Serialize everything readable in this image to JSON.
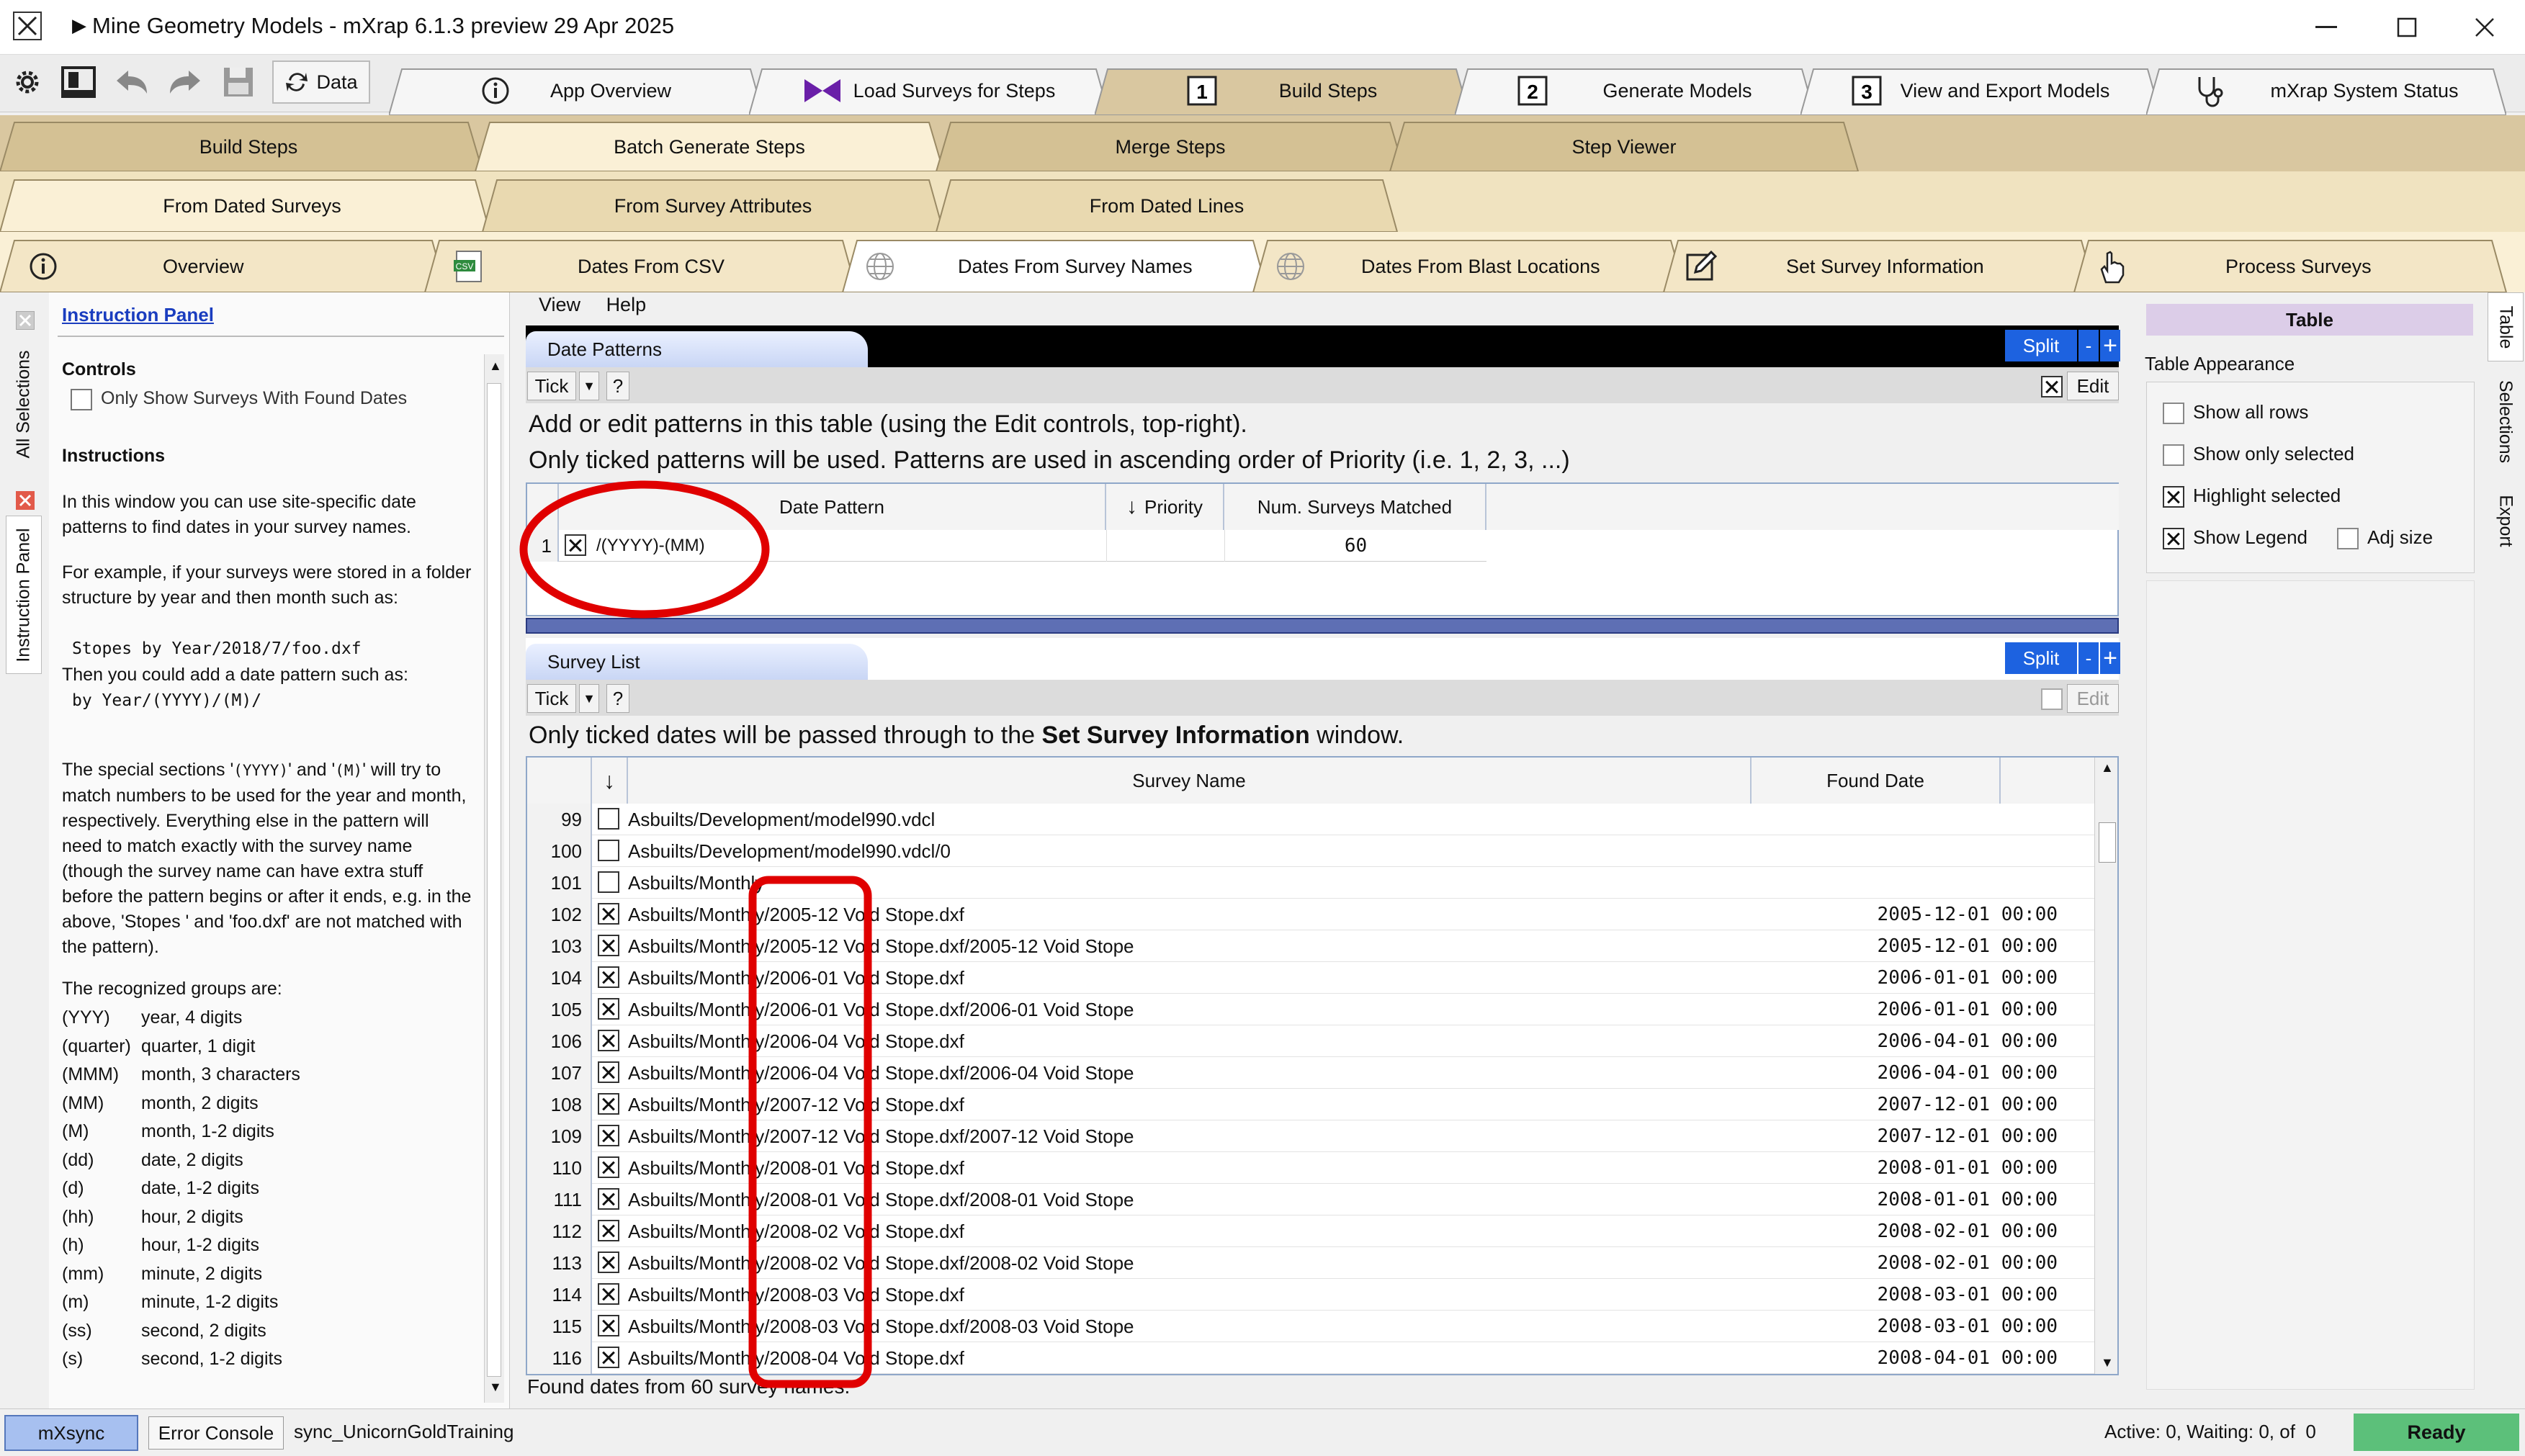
{
  "window": {
    "title": "Mine Geometry Models - mXrap 6.1.3 preview 29 Apr 2025"
  },
  "toolbar": {
    "data_label": "Data"
  },
  "main_tabs": [
    {
      "label": "App Overview",
      "icon": "info-icon"
    },
    {
      "label": "Load Surveys for Steps",
      "icon": "bowtie-icon"
    },
    {
      "label": "Build Steps",
      "icon": "step-1-icon"
    },
    {
      "label": "Generate Models",
      "icon": "step-2-icon"
    },
    {
      "label": "View and Export Models",
      "icon": "step-3-icon"
    },
    {
      "label": "mXrap System Status",
      "icon": "stethoscope-icon"
    }
  ],
  "sub_tabs": [
    "Build Steps",
    "Batch Generate Steps",
    "Merge Steps",
    "Step Viewer"
  ],
  "sub_sub_tabs": [
    "From Dated Surveys",
    "From Survey Attributes",
    "From Dated Lines"
  ],
  "page_tabs": [
    {
      "label": "Overview",
      "icon": "info-icon"
    },
    {
      "label": "Dates From CSV",
      "icon": "csv-icon"
    },
    {
      "label": "Dates From Survey Names",
      "icon": "globe-icon"
    },
    {
      "label": "Dates From Blast Locations",
      "icon": "globe-icon"
    },
    {
      "label": "Set Survey Information",
      "icon": "edit-icon"
    },
    {
      "label": "Process Surveys",
      "icon": "hand-icon"
    }
  ],
  "left_vtabs": [
    "All Selections",
    "Instruction Panel"
  ],
  "instruction_panel": {
    "title": "Instruction Panel",
    "controls_heading": "Controls",
    "only_show_label": "Only Show Surveys With Found Dates",
    "instructions_heading": "Instructions",
    "p1": "In this window you can use site-specific date patterns to find dates in your survey names.",
    "p2": "For example, if your surveys were stored in a folder structure by year and then month such as:",
    "code1": "Stopes by Year/2018/7/foo.dxf",
    "p3": "Then you could add a date pattern such as:",
    "code2": "by Year/(YYYY)/(M)/",
    "p4a": "The special sections '",
    "p4code1": "(YYYY)",
    "p4b": "' and '",
    "p4code2": "(M)",
    "p4c": "' will try to match numbers to be used for the year and month, respectively. Everything else in the pattern will need to match exactly with the survey name (though the survey name can have extra stuff before the pattern begins or after it ends, e.g. in the above, 'Stopes ' and 'foo.dxf' are not matched with the pattern).",
    "groups_heading": "The recognized groups are:",
    "groups": [
      {
        "k": "(YYY)",
        "v": "year, 4 digits"
      },
      {
        "k": "(quarter)",
        "v": "quarter, 1 digit"
      },
      {
        "k": "(MMM)",
        "v": "month, 3 characters"
      },
      {
        "k": "(MM)",
        "v": "month, 2 digits"
      },
      {
        "k": "(M)",
        "v": "month, 1-2 digits"
      },
      {
        "k": "(dd)",
        "v": "date, 2 digits"
      },
      {
        "k": "(d)",
        "v": "date, 1-2 digits"
      },
      {
        "k": "(hh)",
        "v": "hour, 2 digits"
      },
      {
        "k": "(h)",
        "v": "hour, 1-2 digits"
      },
      {
        "k": "(mm)",
        "v": "minute, 2 digits"
      },
      {
        "k": "(m)",
        "v": "minute, 1-2 digits"
      },
      {
        "k": "(ss)",
        "v": "second, 2 digits"
      },
      {
        "k": "(s)",
        "v": "second, 1-2 digits"
      }
    ]
  },
  "menu": [
    "View",
    "Help"
  ],
  "date_patterns": {
    "title": "Date Patterns",
    "split": "Split",
    "minus": "-",
    "plus": "+",
    "tick": "Tick",
    "help": "?",
    "edit": "Edit",
    "line1": "Add or edit patterns in this table (using the Edit controls, top-right).",
    "line2": "Only ticked patterns will be used. Patterns are used in ascending order of Priority (i.e. 1, 2, 3, ...)",
    "columns": [
      "Date Pattern",
      "Priority",
      "Num. Surveys Matched"
    ],
    "rows": [
      {
        "num": "1",
        "checked": true,
        "pattern": "/(YYYY)-(MM)",
        "priority": "",
        "matched": "60"
      }
    ]
  },
  "survey_list": {
    "title": "Survey List",
    "split": "Split",
    "minus": "-",
    "plus": "+",
    "tick": "Tick",
    "help": "?",
    "edit": "Edit",
    "info_prefix": "Only ticked dates will be passed through to the ",
    "info_bold": "Set Survey Information",
    "info_suffix": " window.",
    "columns": [
      "Survey Name",
      "Found Date"
    ],
    "rows": [
      {
        "num": "99",
        "checked": false,
        "name": "Asbuilts/Development/model990.vdcl",
        "date": ""
      },
      {
        "num": "100",
        "checked": false,
        "name": "Asbuilts/Development/model990.vdcl/0",
        "date": ""
      },
      {
        "num": "101",
        "checked": false,
        "name": "Asbuilts/Monthly",
        "date": ""
      },
      {
        "num": "102",
        "checked": true,
        "name": "Asbuilts/Monthly/2005-12 Void Stope.dxf",
        "date": "2005-12-01 00:00"
      },
      {
        "num": "103",
        "checked": true,
        "name": "Asbuilts/Monthly/2005-12 Void Stope.dxf/2005-12 Void Stope",
        "date": "2005-12-01 00:00"
      },
      {
        "num": "104",
        "checked": true,
        "name": "Asbuilts/Monthly/2006-01 Void Stope.dxf",
        "date": "2006-01-01 00:00"
      },
      {
        "num": "105",
        "checked": true,
        "name": "Asbuilts/Monthly/2006-01 Void Stope.dxf/2006-01 Void Stope",
        "date": "2006-01-01 00:00"
      },
      {
        "num": "106",
        "checked": true,
        "name": "Asbuilts/Monthly/2006-04 Void Stope.dxf",
        "date": "2006-04-01 00:00"
      },
      {
        "num": "107",
        "checked": true,
        "name": "Asbuilts/Monthly/2006-04 Void Stope.dxf/2006-04 Void Stope",
        "date": "2006-04-01 00:00"
      },
      {
        "num": "108",
        "checked": true,
        "name": "Asbuilts/Monthly/2007-12 Void Stope.dxf",
        "date": "2007-12-01 00:00"
      },
      {
        "num": "109",
        "checked": true,
        "name": "Asbuilts/Monthly/2007-12 Void Stope.dxf/2007-12 Void Stope",
        "date": "2007-12-01 00:00"
      },
      {
        "num": "110",
        "checked": true,
        "name": "Asbuilts/Monthly/2008-01 Void Stope.dxf",
        "date": "2008-01-01 00:00"
      },
      {
        "num": "111",
        "checked": true,
        "name": "Asbuilts/Monthly/2008-01 Void Stope.dxf/2008-01 Void Stope",
        "date": "2008-01-01 00:00"
      },
      {
        "num": "112",
        "checked": true,
        "name": "Asbuilts/Monthly/2008-02 Void Stope.dxf",
        "date": "2008-02-01 00:00"
      },
      {
        "num": "113",
        "checked": true,
        "name": "Asbuilts/Monthly/2008-02 Void Stope.dxf/2008-02 Void Stope",
        "date": "2008-02-01 00:00"
      },
      {
        "num": "114",
        "checked": true,
        "name": "Asbuilts/Monthly/2008-03 Void Stope.dxf",
        "date": "2008-03-01 00:00"
      },
      {
        "num": "115",
        "checked": true,
        "name": "Asbuilts/Monthly/2008-03 Void Stope.dxf/2008-03 Void Stope",
        "date": "2008-03-01 00:00"
      },
      {
        "num": "116",
        "checked": true,
        "name": "Asbuilts/Monthly/2008-04 Void Stope.dxf",
        "date": "2008-04-01 00:00"
      }
    ],
    "footer": "Found dates from 60 survey names."
  },
  "right_panel": {
    "header": "Table",
    "section": "Table Appearance",
    "options": [
      {
        "label": "Show all rows",
        "checked": false
      },
      {
        "label": "Show only selected",
        "checked": false
      },
      {
        "label": "Highlight selected",
        "checked": true
      },
      {
        "label": "Show Legend",
        "checked": true
      },
      {
        "label": "Adj size",
        "checked": false
      }
    ]
  },
  "right_vtabs": [
    "Table",
    "Selections",
    "Export"
  ],
  "status": {
    "mxsync": "mXsync",
    "error_console": "Error Console",
    "sync_name": "sync_UnicornGoldTraining",
    "activity": "Active: 0, Waiting: 0, of  0",
    "ready": "Ready"
  },
  "colors": {
    "accent_blue": "#1d62e0",
    "annotation_red": "#e00000",
    "ready_green": "#5cc07a"
  }
}
